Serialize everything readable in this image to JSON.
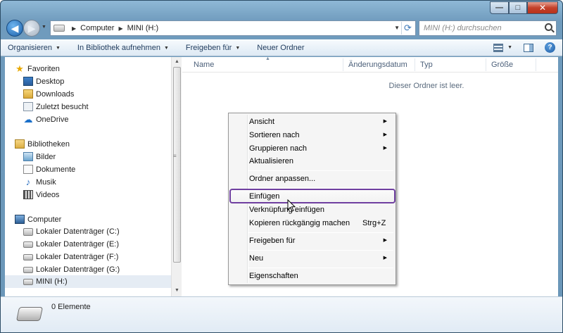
{
  "window": {
    "min": "—",
    "max": "□",
    "close": "✕"
  },
  "nav": {
    "back_icon": "arrow-left-icon",
    "forward_icon": "arrow-right-icon"
  },
  "address": {
    "crumbs": [
      "Computer",
      "MINI (H:)"
    ]
  },
  "search": {
    "placeholder": "MINI (H:) durchsuchen"
  },
  "toolbar": {
    "organize": "Organisieren",
    "include_library": "In Bibliothek aufnehmen",
    "share_with": "Freigeben für",
    "new_folder": "Neuer Ordner",
    "help": "?"
  },
  "sidebar": {
    "favorites": {
      "label": "Favoriten",
      "items": [
        "Desktop",
        "Downloads",
        "Zuletzt besucht",
        "OneDrive"
      ]
    },
    "libraries": {
      "label": "Bibliotheken",
      "items": [
        "Bilder",
        "Dokumente",
        "Musik",
        "Videos"
      ]
    },
    "computer": {
      "label": "Computer",
      "items": [
        "Lokaler Datenträger (C:)",
        "Lokaler Datenträger (E:)",
        "Lokaler Datenträger (F:)",
        "Lokaler Datenträger (G:)",
        "MINI (H:)"
      ]
    },
    "grip": "≡"
  },
  "columns": {
    "name": "Name",
    "modified": "Änderungsdatum",
    "type": "Typ",
    "size": "Größe"
  },
  "empty_text": "Dieser Ordner ist leer.",
  "context_menu": {
    "view": "Ansicht",
    "sort_by": "Sortieren nach",
    "group_by": "Gruppieren nach",
    "refresh": "Aktualisieren",
    "customize": "Ordner anpassen...",
    "paste": "Einfügen",
    "paste_shortcut": "Verknüpfung einfügen",
    "undo_copy": "Kopieren rückgängig machen",
    "undo_shortcut": "Strg+Z",
    "share_with": "Freigeben für",
    "new": "Neu",
    "properties": "Eigenschaften"
  },
  "details": {
    "count": "0 Elemente"
  },
  "colors": {
    "highlight_border": "#6f3fa0",
    "accent": "#1a5fa8"
  }
}
